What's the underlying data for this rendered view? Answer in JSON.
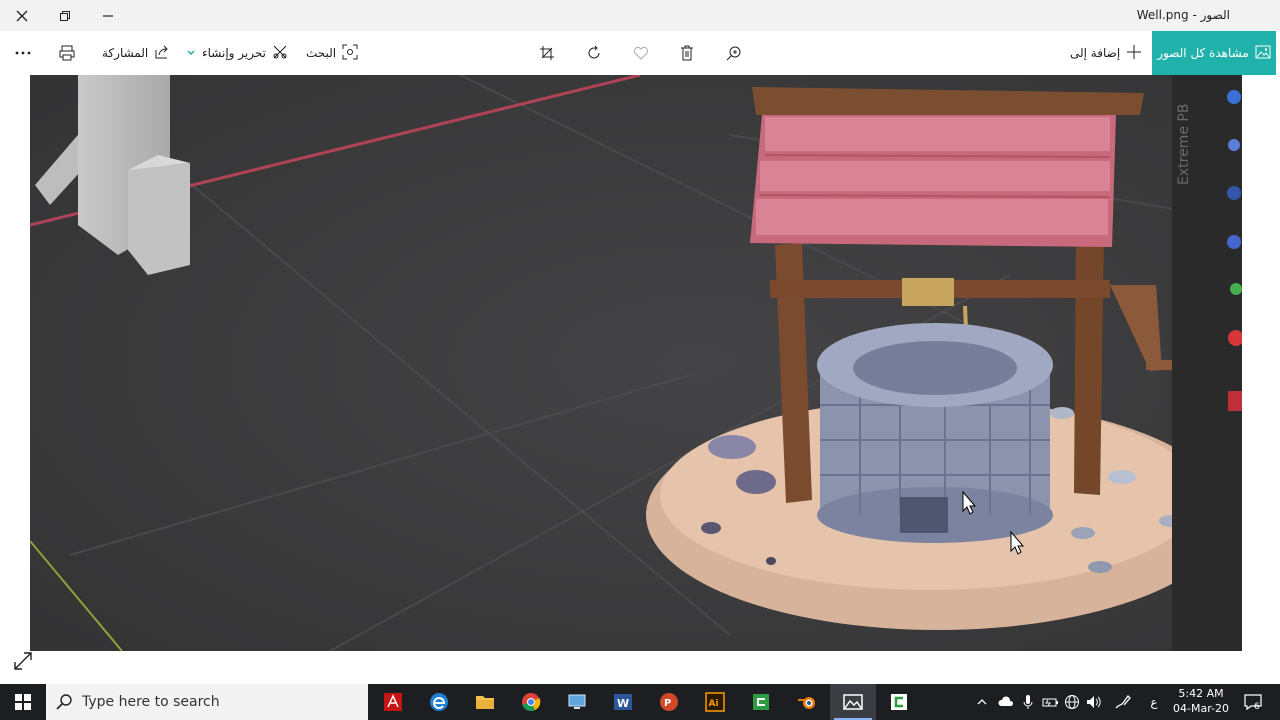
{
  "window": {
    "title": "الصور - Well.png"
  },
  "toolbar": {
    "add_to_label": "إضافة إلى",
    "see_all_label": "مشاهدة كل الصور",
    "search_label": "البحث",
    "edit_create_label": "تحرير وإنشاء",
    "share_label": "المشاركة"
  },
  "taskbar": {
    "search_placeholder": "Type here to search",
    "lang": "ع",
    "time": "5:42 AM",
    "date": "04-Mar-20",
    "notification_count": "6"
  },
  "image_overlay": {
    "sidebar_text": "Extreme PB"
  },
  "icons": {
    "close": "close-icon",
    "restore": "restore-icon",
    "minimize": "minimize-icon",
    "more": "more-icon",
    "print": "print-icon",
    "share": "share-icon",
    "edit": "edit-icon",
    "search": "search-icon",
    "crop": "crop-icon",
    "rotate": "rotate-icon",
    "favorite": "heart-icon",
    "delete": "trash-icon",
    "zoom": "zoom-icon",
    "add": "plus-icon",
    "gallery": "gallery-icon"
  },
  "colors": {
    "accent": "#20b2aa",
    "taskbar": "#1d1e22",
    "viewport": "#3a3a3b"
  }
}
